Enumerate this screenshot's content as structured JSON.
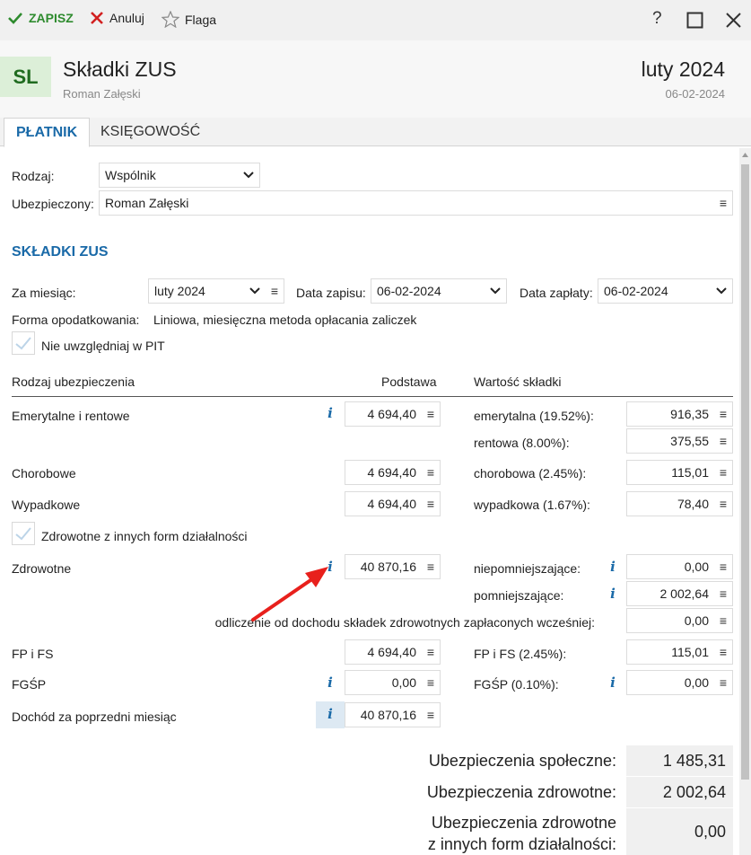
{
  "toolbar": {
    "save_label": "ZAPISZ",
    "cancel_label": "Anuluj",
    "flag_label": "Flaga",
    "help_label": "?"
  },
  "header": {
    "avatar_initials": "SL",
    "title": "Składki ZUS",
    "subtitle": "Roman Załęski",
    "period": "luty 2024",
    "date": "06-02-2024"
  },
  "tabs": [
    {
      "label": "PŁATNIK",
      "active": true
    },
    {
      "label": "KSIĘGOWOŚĆ",
      "active": false
    }
  ],
  "form": {
    "rodzaj_label": "Rodzaj:",
    "rodzaj_value": "Wspólnik",
    "ubezpieczony_label": "Ubezpieczony:",
    "ubezpieczony_value": "Roman Załęski"
  },
  "skladki": {
    "title": "SKŁADKI ZUS",
    "za_miesiac_label": "Za miesiąc:",
    "za_miesiac_value": "luty 2024",
    "data_zapisu_label": "Data zapisu:",
    "data_zapisu_value": "06-02-2024",
    "data_zaplaty_label": "Data zapłaty:",
    "data_zaplaty_value": "06-02-2024",
    "forma_label": "Forma opodatkowania:",
    "forma_value": "Liniowa, miesięczna metoda opłacania zaliczek",
    "pit_checkbox_label": "Nie uwzględniaj w PIT",
    "col_rodzaj": "Rodzaj ubezpieczenia",
    "col_podstawa": "Podstawa",
    "col_wartosc": "Wartość składki",
    "emerytalne_label": "Emerytalne i rentowe",
    "emerytalne_podstawa": "4 694,40",
    "emerytalna_label": "emerytalna (19.52%):",
    "emerytalna_value": "916,35",
    "rentowa_label": "rentowa (8.00%):",
    "rentowa_value": "375,55",
    "chorobowe_label": "Chorobowe",
    "chorobowe_podstawa": "4 694,40",
    "chorobowa_label": "chorobowa (2.45%):",
    "chorobowa_value": "115,01",
    "wypadkowe_label": "Wypadkowe",
    "wypadkowe_podstawa": "4 694,40",
    "wypadkowa_label": "wypadkowa (1.67%):",
    "wypadkowa_value": "78,40",
    "zdrowotne_inne_checkbox_label": "Zdrowotne z innych form działalności",
    "zdrowotne_label": "Zdrowotne",
    "zdrowotne_podstawa": "40 870,16",
    "niepomniejszajace_label": "niepomniejszające:",
    "niepomniejszajace_value": "0,00",
    "pomniejszajace_label": "pomniejszające:",
    "pomniejszajace_value": "2 002,64",
    "odliczenie_label": "odliczenie od dochodu składek zdrowotnych zapłaconych wcześniej:",
    "odliczenie_value": "0,00",
    "fpfs_label": "FP i FS",
    "fpfs_podstawa": "4 694,40",
    "fpfs_sk_label": "FP i FS (2.45%):",
    "fpfs_sk_value": "115,01",
    "fgsp_label": "FGŚP",
    "fgsp_podstawa": "0,00",
    "fgsp_sk_label": "FGŚP (0.10%):",
    "fgsp_sk_value": "0,00",
    "dochod_label": "Dochód za poprzedni miesiąc",
    "dochod_value": "40 870,16"
  },
  "summary": {
    "spoleczne_label": "Ubezpieczenia społeczne:",
    "spoleczne_value": "1 485,31",
    "zdrowotne_label": "Ubezpieczenia zdrowotne:",
    "zdrowotne_value": "2 002,64",
    "inne_label_line1": "Ubezpieczenia zdrowotne",
    "inne_label_line2": "z innych form działalności:",
    "inne_value": "0,00"
  },
  "colors": {
    "accent": "#1a6aa8",
    "save_green": "#2e8b2e",
    "cancel_red": "#d22020",
    "arrow_red": "#e8201c"
  }
}
